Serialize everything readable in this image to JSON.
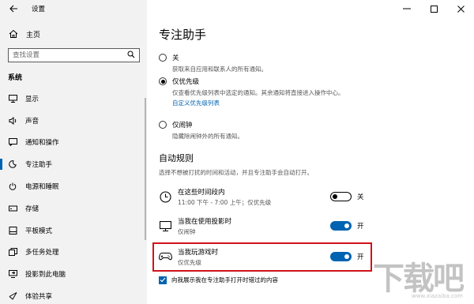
{
  "app": {
    "title": "设置"
  },
  "sidebar": {
    "home_label": "主页",
    "search_placeholder": "查找设置",
    "section": "系统",
    "items": [
      {
        "label": "显示",
        "icon": "monitor-icon"
      },
      {
        "label": "声音",
        "icon": "speaker-icon"
      },
      {
        "label": "通知和操作",
        "icon": "notification-icon"
      },
      {
        "label": "专注助手",
        "icon": "moon-icon",
        "active": true
      },
      {
        "label": "电源和睡眠",
        "icon": "power-icon"
      },
      {
        "label": "存储",
        "icon": "storage-icon"
      },
      {
        "label": "平板模式",
        "icon": "tablet-icon"
      },
      {
        "label": "多任务处理",
        "icon": "multitask-icon"
      },
      {
        "label": "投影到此电脑",
        "icon": "project-icon"
      },
      {
        "label": "体验共享",
        "icon": "share-icon"
      }
    ]
  },
  "main": {
    "title": "专注助手",
    "options": [
      {
        "label": "关",
        "desc": "获取来自应用和联系人的所有通知。",
        "selected": false
      },
      {
        "label": "仅优先级",
        "desc": "仅查看优先级列表中选定的通知。其余通知将直接进入操作中心。",
        "link": "自定义优先级列表",
        "selected": true
      },
      {
        "label": "仅闹钟",
        "desc": "隐藏除闹钟外的所有通知。",
        "selected": false
      }
    ],
    "auto_rules": {
      "heading": "自动规则",
      "desc": "选择不想被打扰的时间和活动，并且专注助手会自动打开。",
      "rules": [
        {
          "name": "在这些时间段内",
          "sub": "11:00 下午 - 7:00 上午；仅优先级",
          "state": "关",
          "on": false
        },
        {
          "name": "当我在使用投影时",
          "sub": "仅闹钟",
          "state": "开",
          "on": true
        },
        {
          "name": "当我玩游戏时",
          "sub": "仅优先级",
          "state": "开",
          "on": true
        }
      ]
    },
    "checkbox_label": "向我展示我在专注助手打开时错过的内容"
  },
  "watermark": {
    "big": "下载吧",
    "small": "www.xiazaiba.com"
  },
  "colors": {
    "accent": "#0063b1",
    "highlight": "#d0121b"
  }
}
